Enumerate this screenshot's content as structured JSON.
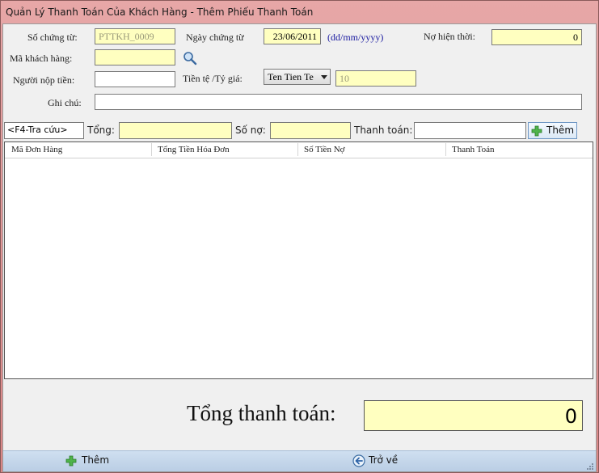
{
  "window": {
    "title": "Quản Lý Thanh Toán Của Khách Hàng - Thêm Phiếu Thanh Toán"
  },
  "form": {
    "so_chung_tu_label": "Số chứng từ:",
    "so_chung_tu_value": "PTTKH_0009",
    "ngay_chung_tu_label": "Ngày chứng từ",
    "ngay_chung_tu_value": "23/06/2011",
    "date_format_hint": "(dd/mm/yyyy)",
    "no_hien_thoi_label": "Nợ hiện thời:",
    "no_hien_thoi_value": "0",
    "ma_khach_hang_label": "Mã khách hàng:",
    "ma_khach_hang_value": "",
    "nguoi_nop_tien_label": "Người nộp tiền:",
    "nguoi_nop_tien_value": "",
    "tien_te_label": "Tiền tệ /Tỷ giá:",
    "tien_te_selected": "Ten Tien Te",
    "ty_gia_value": "10",
    "ghi_chu_label": "Ghi chú:",
    "ghi_chu_value": ""
  },
  "search_row": {
    "lookup_value": "<F4-Tra cứu>",
    "tong_label": "Tổng:",
    "tong_value": "",
    "so_no_label": "Số nợ:",
    "so_no_value": "",
    "thanh_toan_label": "Thanh toán:",
    "thanh_toan_value": "",
    "add_label": "Thêm"
  },
  "grid": {
    "columns": [
      "Mã Đơn Hàng",
      "Tổng Tiền Hóa Đơn",
      "Số Tiền Nợ",
      "Thanh Toán"
    ],
    "rows": []
  },
  "summary": {
    "tong_thanh_toan_label": "Tổng thanh toán:",
    "tong_thanh_toan_value": "0"
  },
  "bottom": {
    "add_label": "Thêm",
    "back_label": "Trở về"
  },
  "icons": {
    "search": "magnifier-icon",
    "add": "green-plus-icon",
    "back": "back-arrow-icon"
  },
  "colors": {
    "title_bar": "#d98686",
    "input_highlight": "#ffffc0",
    "bottom_bar": "#c3d5ea",
    "hint_text": "#1a1aa0"
  }
}
